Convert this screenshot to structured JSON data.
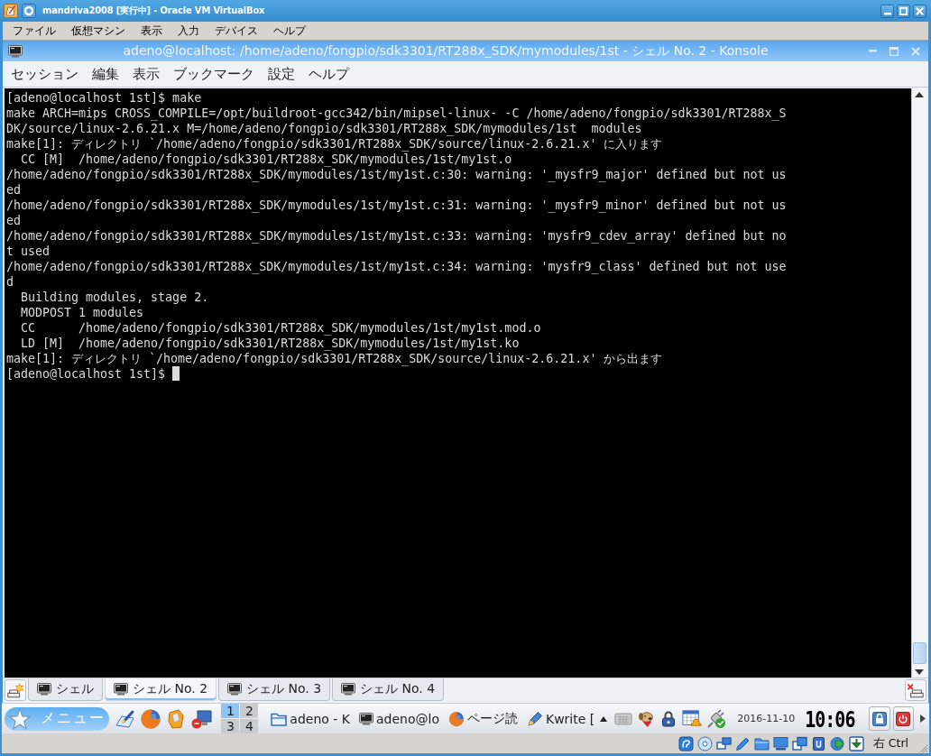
{
  "vbox_window": {
    "title": "mandriva2008 [実行中] - Oracle VM VirtualBox",
    "menu": [
      "ファイル",
      "仮想マシン",
      "表示",
      "入力",
      "デバイス",
      "ヘルプ"
    ]
  },
  "konsole": {
    "title": "adeno@localhost: /home/adeno/fongpio/sdk3301/RT288x_SDK/mymodules/1st - シェル No. 2 - Konsole",
    "menu": [
      "セッション",
      "編集",
      "表示",
      "ブックマーク",
      "設定",
      "ヘルプ"
    ],
    "terminal": {
      "lines": [
        "[adeno@localhost 1st]$ make",
        "make ARCH=mips CROSS_COMPILE=/opt/buildroot-gcc342/bin/mipsel-linux- -C /home/adeno/fongpio/sdk3301/RT288x_S",
        "DK/source/linux-2.6.21.x M=/home/adeno/fongpio/sdk3301/RT288x_SDK/mymodules/1st  modules",
        "make[1]: ディレクトリ `/home/adeno/fongpio/sdk3301/RT288x_SDK/source/linux-2.6.21.x' に入ります",
        "  CC [M]  /home/adeno/fongpio/sdk3301/RT288x_SDK/mymodules/1st/my1st.o",
        "/home/adeno/fongpio/sdk3301/RT288x_SDK/mymodules/1st/my1st.c:30: warning: '_mysfr9_major' defined but not us",
        "ed",
        "/home/adeno/fongpio/sdk3301/RT288x_SDK/mymodules/1st/my1st.c:31: warning: '_mysfr9_minor' defined but not us",
        "ed",
        "/home/adeno/fongpio/sdk3301/RT288x_SDK/mymodules/1st/my1st.c:33: warning: 'mysfr9_cdev_array' defined but no",
        "t used",
        "/home/adeno/fongpio/sdk3301/RT288x_SDK/mymodules/1st/my1st.c:34: warning: 'mysfr9_class' defined but not use",
        "d",
        "  Building modules, stage 2.",
        "  MODPOST 1 modules",
        "  CC      /home/adeno/fongpio/sdk3301/RT288x_SDK/mymodules/1st/my1st.mod.o",
        "  LD [M]  /home/adeno/fongpio/sdk3301/RT288x_SDK/mymodules/1st/my1st.ko",
        "make[1]: ディレクトリ `/home/adeno/fongpio/sdk3301/RT288x_SDK/source/linux-2.6.21.x' から出ます",
        "[adeno@localhost 1st]$"
      ],
      "cursor": true
    },
    "tabs": [
      {
        "label": "シェル",
        "selected": false
      },
      {
        "label": "シェル No. 2",
        "selected": true
      },
      {
        "label": "シェル No. 3",
        "selected": false
      },
      {
        "label": "シェル No. 4",
        "selected": false
      }
    ]
  },
  "taskbar": {
    "menu_button": "メニュー",
    "pager": [
      {
        "label": "1",
        "selected": true
      },
      {
        "label": "2",
        "selected": false
      },
      {
        "label": "3",
        "selected": false
      },
      {
        "label": "4",
        "selected": false
      }
    ],
    "tasks": [
      {
        "label": "adeno - K",
        "kind": "folder"
      },
      {
        "label": "adeno@lo",
        "kind": "terminal"
      },
      {
        "label": "ページ読",
        "kind": "browser"
      },
      {
        "label": "Kwrite [",
        "kind": "editor"
      }
    ],
    "date": "2016-11-10",
    "clock": "10:06"
  },
  "status_bar": {
    "host_key": "右 Ctrl"
  }
}
